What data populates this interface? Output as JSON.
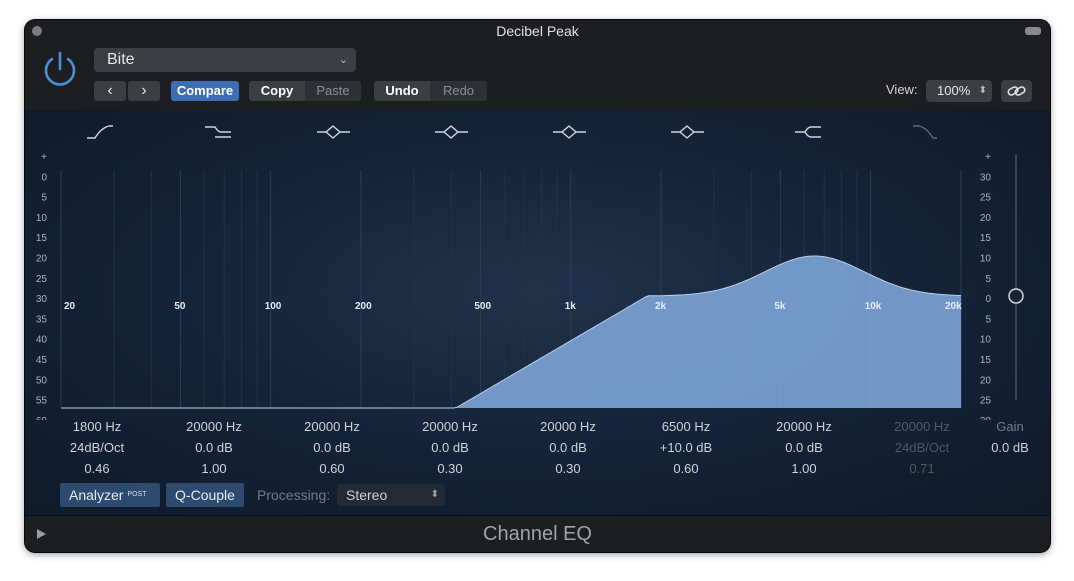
{
  "window": {
    "title": "Decibel Peak"
  },
  "toolbar": {
    "preset": "Bite",
    "prev_label": "‹",
    "next_label": "›",
    "compare_label": "Compare",
    "copy_label": "Copy",
    "paste_label": "Paste",
    "undo_label": "Undo",
    "redo_label": "Redo",
    "view_label": "View:",
    "view_value": "100%"
  },
  "graph": {
    "left_scale": [
      "+",
      "0",
      "5",
      "10",
      "15",
      "20",
      "25",
      "30",
      "35",
      "40",
      "45",
      "50",
      "55",
      "60",
      "–"
    ],
    "right_scale": [
      "+",
      "30",
      "25",
      "20",
      "15",
      "10",
      "5",
      "0",
      "5",
      "10",
      "15",
      "20",
      "25",
      "30",
      "–"
    ],
    "freq_labels": [
      "20",
      "50",
      "100",
      "200",
      "500",
      "1k",
      "2k",
      "5k",
      "10k",
      "20k"
    ],
    "fill_color": "#7ba2d4"
  },
  "bands": [
    {
      "icon": "low-cut-icon",
      "freq": "1800 Hz",
      "gain": "24dB/Oct",
      "q": "0.46",
      "active": true
    },
    {
      "icon": "low-shelf-icon",
      "freq": "20000 Hz",
      "gain": "0.0 dB",
      "q": "1.00",
      "active": true
    },
    {
      "icon": "peak-icon",
      "freq": "20000 Hz",
      "gain": "0.0 dB",
      "q": "0.60",
      "active": true
    },
    {
      "icon": "peak-icon",
      "freq": "20000 Hz",
      "gain": "0.0 dB",
      "q": "0.30",
      "active": true
    },
    {
      "icon": "peak-icon",
      "freq": "20000 Hz",
      "gain": "0.0 dB",
      "q": "0.30",
      "active": true
    },
    {
      "icon": "peak-icon",
      "freq": "6500 Hz",
      "gain": "+10.0 dB",
      "q": "0.60",
      "active": true
    },
    {
      "icon": "high-shelf-icon",
      "freq": "20000 Hz",
      "gain": "0.0 dB",
      "q": "1.00",
      "active": true
    },
    {
      "icon": "high-cut-icon",
      "freq": "20000 Hz",
      "gain": "24dB/Oct",
      "q": "0.71",
      "active": false
    }
  ],
  "gain": {
    "label": "Gain",
    "value": "0.0 dB"
  },
  "bottom": {
    "analyzer_label": "Analyzer",
    "analyzer_tag": "POST",
    "qcouple_label": "Q-Couple",
    "processing_label": "Processing:",
    "processing_value": "Stereo"
  },
  "footer": {
    "title": "Channel EQ"
  },
  "colors": {
    "accent": "#3d6db5",
    "background": "#1c1e22",
    "curve_fill": "#7ba2d4"
  }
}
